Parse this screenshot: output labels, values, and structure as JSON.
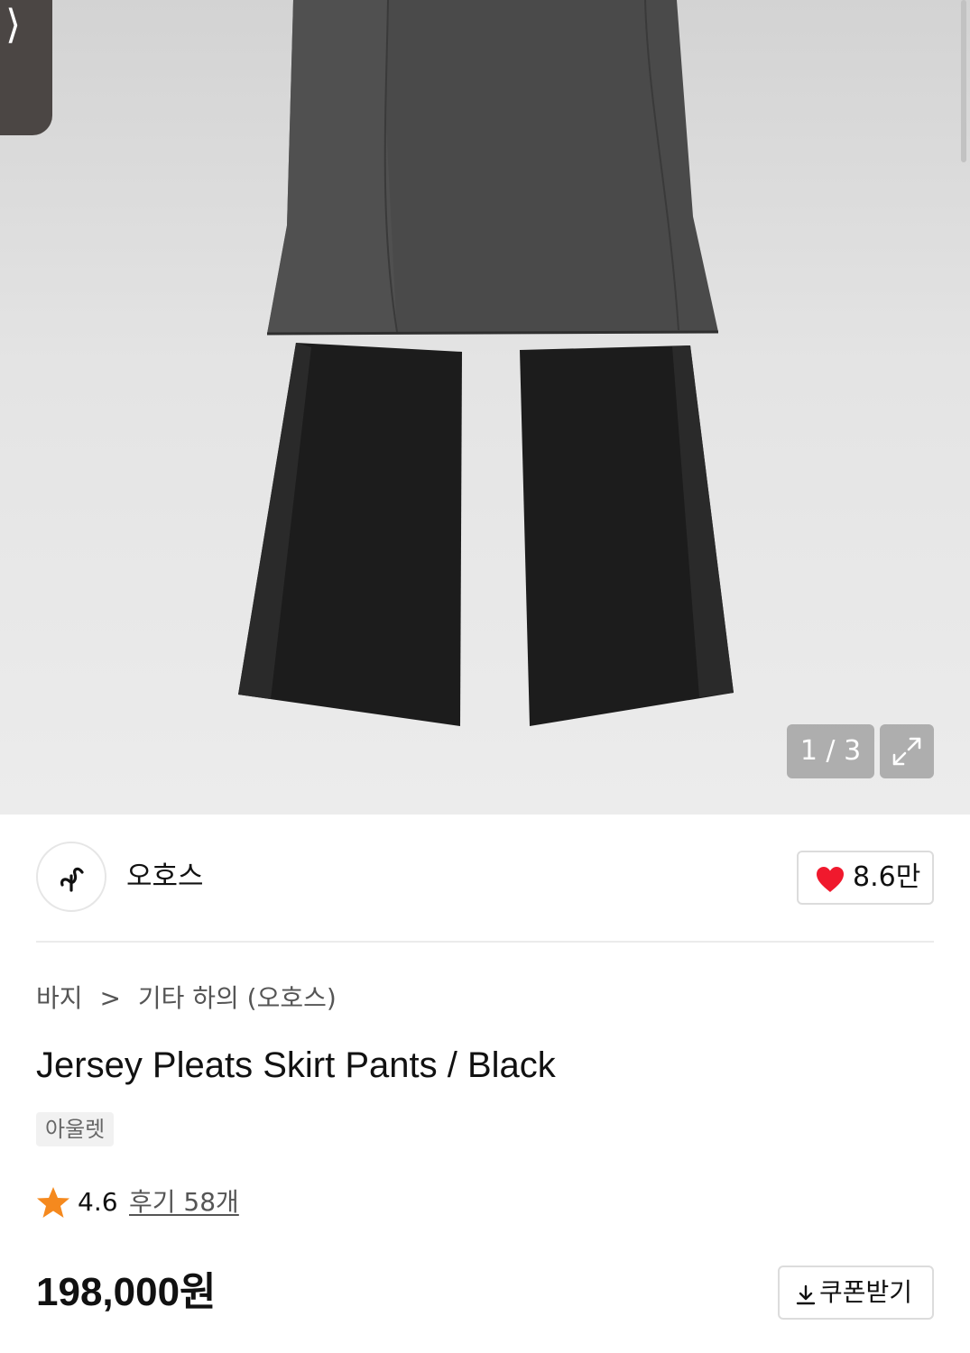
{
  "gallery": {
    "counter": "1 / 3",
    "prev_icon": "chevron-right-icon",
    "expand_icon": "expand-icon"
  },
  "brand": {
    "name": "오호스",
    "logo_icon": "brand-logo-icon",
    "like_icon": "heart-icon",
    "like_count": "8.6만",
    "heart_color": "#f0192d"
  },
  "breadcrumb": {
    "category": "바지",
    "separator": ">",
    "subcategory": "기타 하의 (오호스)"
  },
  "product": {
    "title": "Jersey Pleats Skirt Pants / Black",
    "tag": "아울렛",
    "rating": "4.6",
    "rating_icon": "star-icon",
    "star_color": "#f5891e",
    "reviews": "후기 58개",
    "price": "198,000원"
  },
  "coupon": {
    "label": "쿠폰받기",
    "icon": "download-icon"
  }
}
